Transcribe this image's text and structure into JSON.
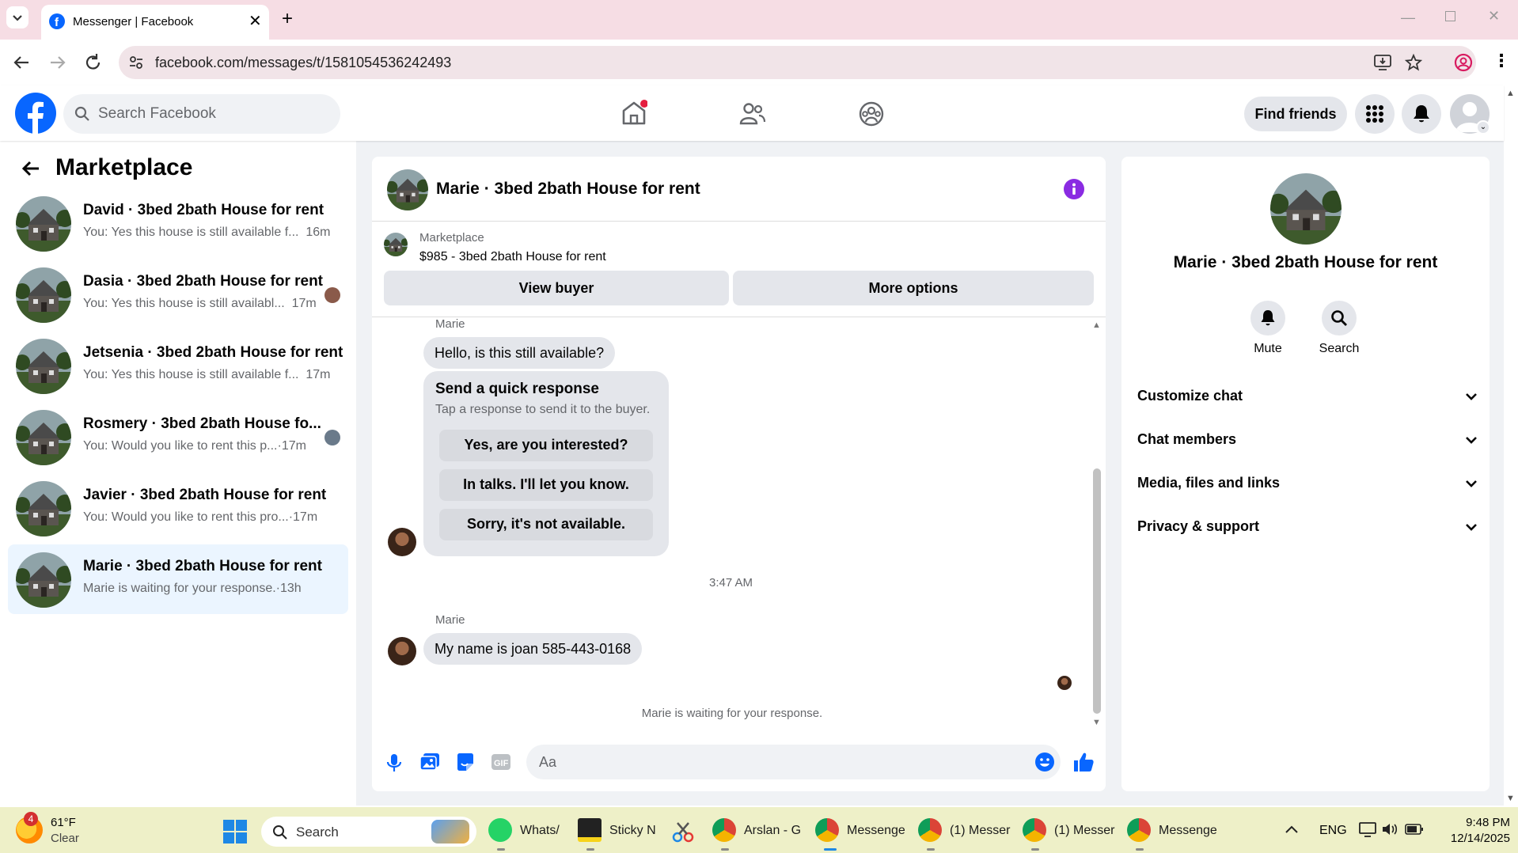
{
  "browser": {
    "tab_title": "Messenger | Facebook",
    "url": "facebook.com/messages/t/1581054536242493"
  },
  "header": {
    "search_placeholder": "Search Facebook",
    "find_friends": "Find friends"
  },
  "left": {
    "title": "Marketplace",
    "conversations": [
      {
        "title": "David · 3bed 2bath House for rent",
        "snippet": "You: Yes this house is still available f...",
        "time": "16m"
      },
      {
        "title": "Dasia · 3bed 2bath House for rent",
        "snippet": "You: Yes this house is still availabl...",
        "time": "17m"
      },
      {
        "title": "Jetsenia · 3bed 2bath House for rent",
        "snippet": "You: Yes this house is still available f...",
        "time": "17m"
      },
      {
        "title": "Rosmery · 3bed 2bath House fo...",
        "snippet": "You: Would you like to rent this p...",
        "time": "·17m"
      },
      {
        "title": "Javier · 3bed 2bath House for rent",
        "snippet": "You: Would you like to rent this pro...",
        "time": "·17m"
      },
      {
        "title": "Marie · 3bed 2bath House for rent",
        "snippet": "Marie is waiting for your response.",
        "time": "·13h"
      }
    ]
  },
  "chat": {
    "title": "Marie · 3bed 2bath House for rent",
    "listing": {
      "label": "Marketplace",
      "price_title": "$985 - 3bed 2bath House for rent"
    },
    "view_buyer": "View buyer",
    "more_options": "More options",
    "sender": "Marie",
    "msg1": "Hello, is this still available?",
    "quick": {
      "title": "Send a quick response",
      "subtitle": "Tap a response to send it to the buyer.",
      "options": [
        "Yes, are you interested?",
        "In talks. I'll let you know.",
        "Sorry, it's not available."
      ]
    },
    "timestamp": "3:47 AM",
    "msg2": "My name is joan 585-443-0168",
    "waiting": "Marie is waiting for your response.",
    "composer_placeholder": "Aa"
  },
  "right": {
    "name": "Marie · 3bed 2bath House for rent",
    "mute": "Mute",
    "search": "Search",
    "sections": [
      "Customize chat",
      "Chat members",
      "Media, files and links",
      "Privacy & support"
    ]
  },
  "taskbar": {
    "weather_temp": "61°F",
    "weather_cond": "Clear",
    "weather_badge": "4",
    "search": "Search",
    "apps": [
      "Whats/",
      "Sticky N",
      "Arslan - G",
      "Messenge",
      "(1) Messer",
      "(1) Messer",
      "Messenge"
    ],
    "lang": "ENG",
    "time": "9:48 PM",
    "date": "12/14/2025"
  },
  "colors": {
    "accent": "#0866ff",
    "purple": "#8a2be2",
    "selected_row": "#ebf5ff"
  }
}
